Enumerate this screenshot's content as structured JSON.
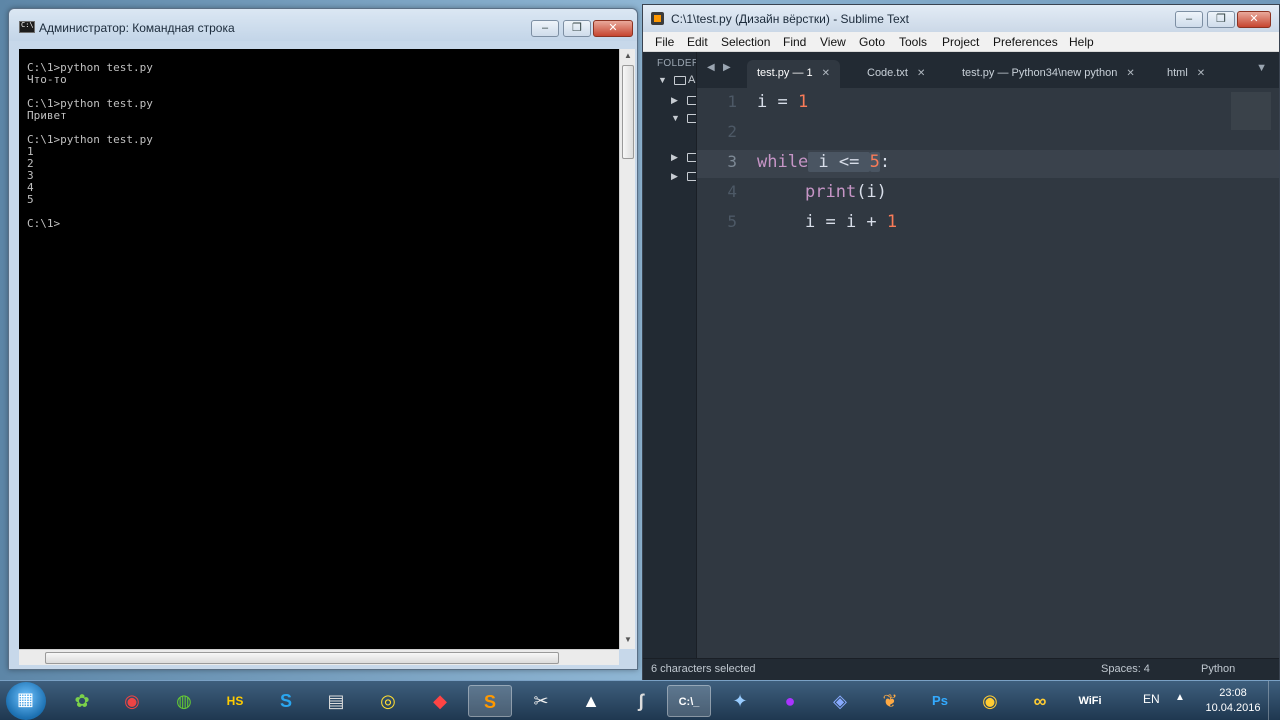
{
  "cmd": {
    "title": "Администратор: Командная строка",
    "lines": [
      "C:\\1>python test.py",
      "Что-то",
      "",
      "C:\\1>python test.py",
      "Привет",
      "",
      "C:\\1>python test.py",
      "1",
      "2",
      "3",
      "4",
      "5",
      "",
      "C:\\1>"
    ]
  },
  "sublime": {
    "title": "C:\\1\\test.py (Дизайн вёрстки) - Sublime Text",
    "menu": [
      "File",
      "Edit",
      "Selection",
      "Find",
      "View",
      "Goto",
      "Tools",
      "Project",
      "Preferences",
      "Help"
    ],
    "sidebar": {
      "folders_label": "FOLDER",
      "first_letter": "A"
    },
    "tabs": [
      {
        "label": "test.py — 1",
        "active": true
      },
      {
        "label": "Code.txt",
        "active": false
      },
      {
        "label": "test.py — Python34\\new python",
        "active": false
      },
      {
        "label": "html",
        "active": false
      }
    ],
    "gutter": [
      "1",
      "2",
      "3",
      "4",
      "5"
    ],
    "code": {
      "line1": {
        "var": "i",
        "op": " = ",
        "num": "1"
      },
      "line3": {
        "kw": "while",
        "cond": " i <= ",
        "num": "5",
        "colon": ":"
      },
      "line4": {
        "fn": "print",
        "rest": "(i)"
      },
      "line5": {
        "text": "i = i + ",
        "num": "1"
      }
    },
    "status": {
      "left": "6 characters selected",
      "spaces": "Spaces: 4",
      "syntax": "Python"
    }
  },
  "taskbar": {
    "lang": "EN",
    "time": "23:08",
    "date": "10.04.2016",
    "icons": [
      "leaf-icon",
      "chrome-icon",
      "globe-icon",
      "hs-icon",
      "skype-icon",
      "archive-icon",
      "network-icon",
      "git-icon",
      "sublime-icon",
      "scissors-icon",
      "arc-icon",
      "wave-icon",
      "cmd-icon",
      "tool-icon",
      "orb-icon",
      "cube-icon",
      "palm-icon",
      "photoshop-icon",
      "chrome-canary-icon",
      "rings-icon",
      "wifi-icon"
    ]
  }
}
